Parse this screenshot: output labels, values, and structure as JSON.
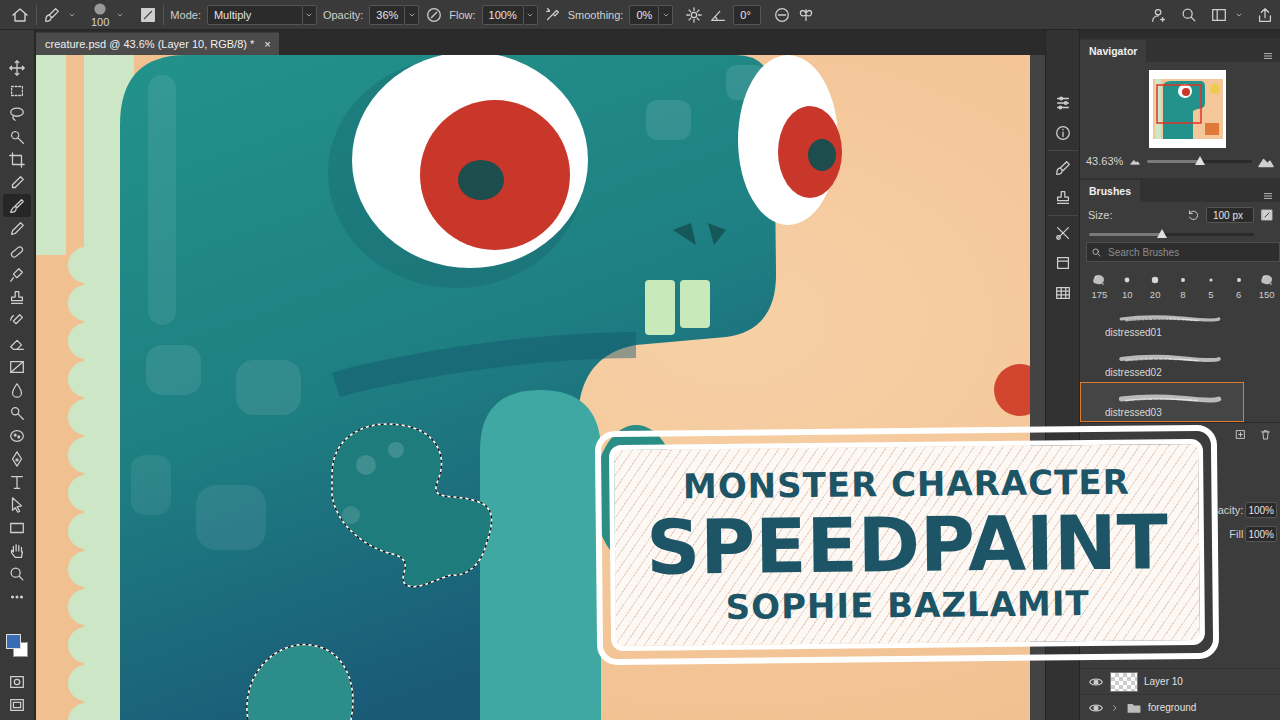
{
  "options_bar": {
    "brush_size": "100",
    "mode_label": "Mode:",
    "mode": "Multiply",
    "opacity_label": "Opacity:",
    "opacity": "36%",
    "flow_label": "Flow:",
    "flow": "100%",
    "smoothing_label": "Smoothing:",
    "smoothing": "0%",
    "angle": "0°"
  },
  "document_tab": {
    "title": "creature.psd @ 43.6% (Layer 10, RGB/8) *",
    "close": "×",
    "selected": true
  },
  "tools": [
    {
      "selected": false
    },
    {
      "selected": false
    },
    {
      "selected": false
    },
    {
      "selected": false
    },
    {
      "selected": false
    },
    {
      "selected": false
    },
    {
      "selected": true
    },
    {
      "selected": false
    },
    {
      "selected": false
    },
    {
      "selected": false
    },
    {
      "selected": false
    },
    {
      "selected": false
    },
    {
      "selected": false
    },
    {
      "selected": false
    },
    {
      "selected": false
    },
    {
      "selected": false
    },
    {
      "selected": false
    },
    {
      "selected": false
    },
    {
      "selected": false
    },
    {
      "selected": false
    },
    {
      "selected": false
    },
    {
      "selected": false
    },
    {
      "selected": false
    },
    {
      "selected": false
    }
  ],
  "swatches": {
    "foreground": "#3a6cb3",
    "background": "#ffffff"
  },
  "navigator": {
    "tab": "Navigator",
    "zoom": "43.63%",
    "zoom_level": 0.5
  },
  "brushes": {
    "tab": "Brushes",
    "size_label": "Size:",
    "size": "100 px",
    "size_level": 0.44,
    "search": {
      "placeholder": "Search Brushes"
    },
    "tips": [
      "175",
      "10",
      "20",
      "8",
      "5",
      "6",
      "150"
    ],
    "presets": [
      {
        "name": "distressed01",
        "selected": false
      },
      {
        "name": "distressed02",
        "selected": false
      },
      {
        "name": "distressed03",
        "selected": true
      }
    ]
  },
  "layers": {
    "opacity_label": "acity:",
    "opacity": "100%",
    "fill_label": "Fill",
    "fill": "100%",
    "rows": [
      {
        "name": "Layer 10",
        "visible": true,
        "kind": "layer"
      },
      {
        "name": "foreground",
        "visible": true,
        "kind": "group"
      }
    ]
  },
  "overlay": {
    "line1": "MONSTER CHARACTER",
    "line2": "SPEEDPAINT",
    "line3": "SOPHIE BAZLAMIT"
  }
}
